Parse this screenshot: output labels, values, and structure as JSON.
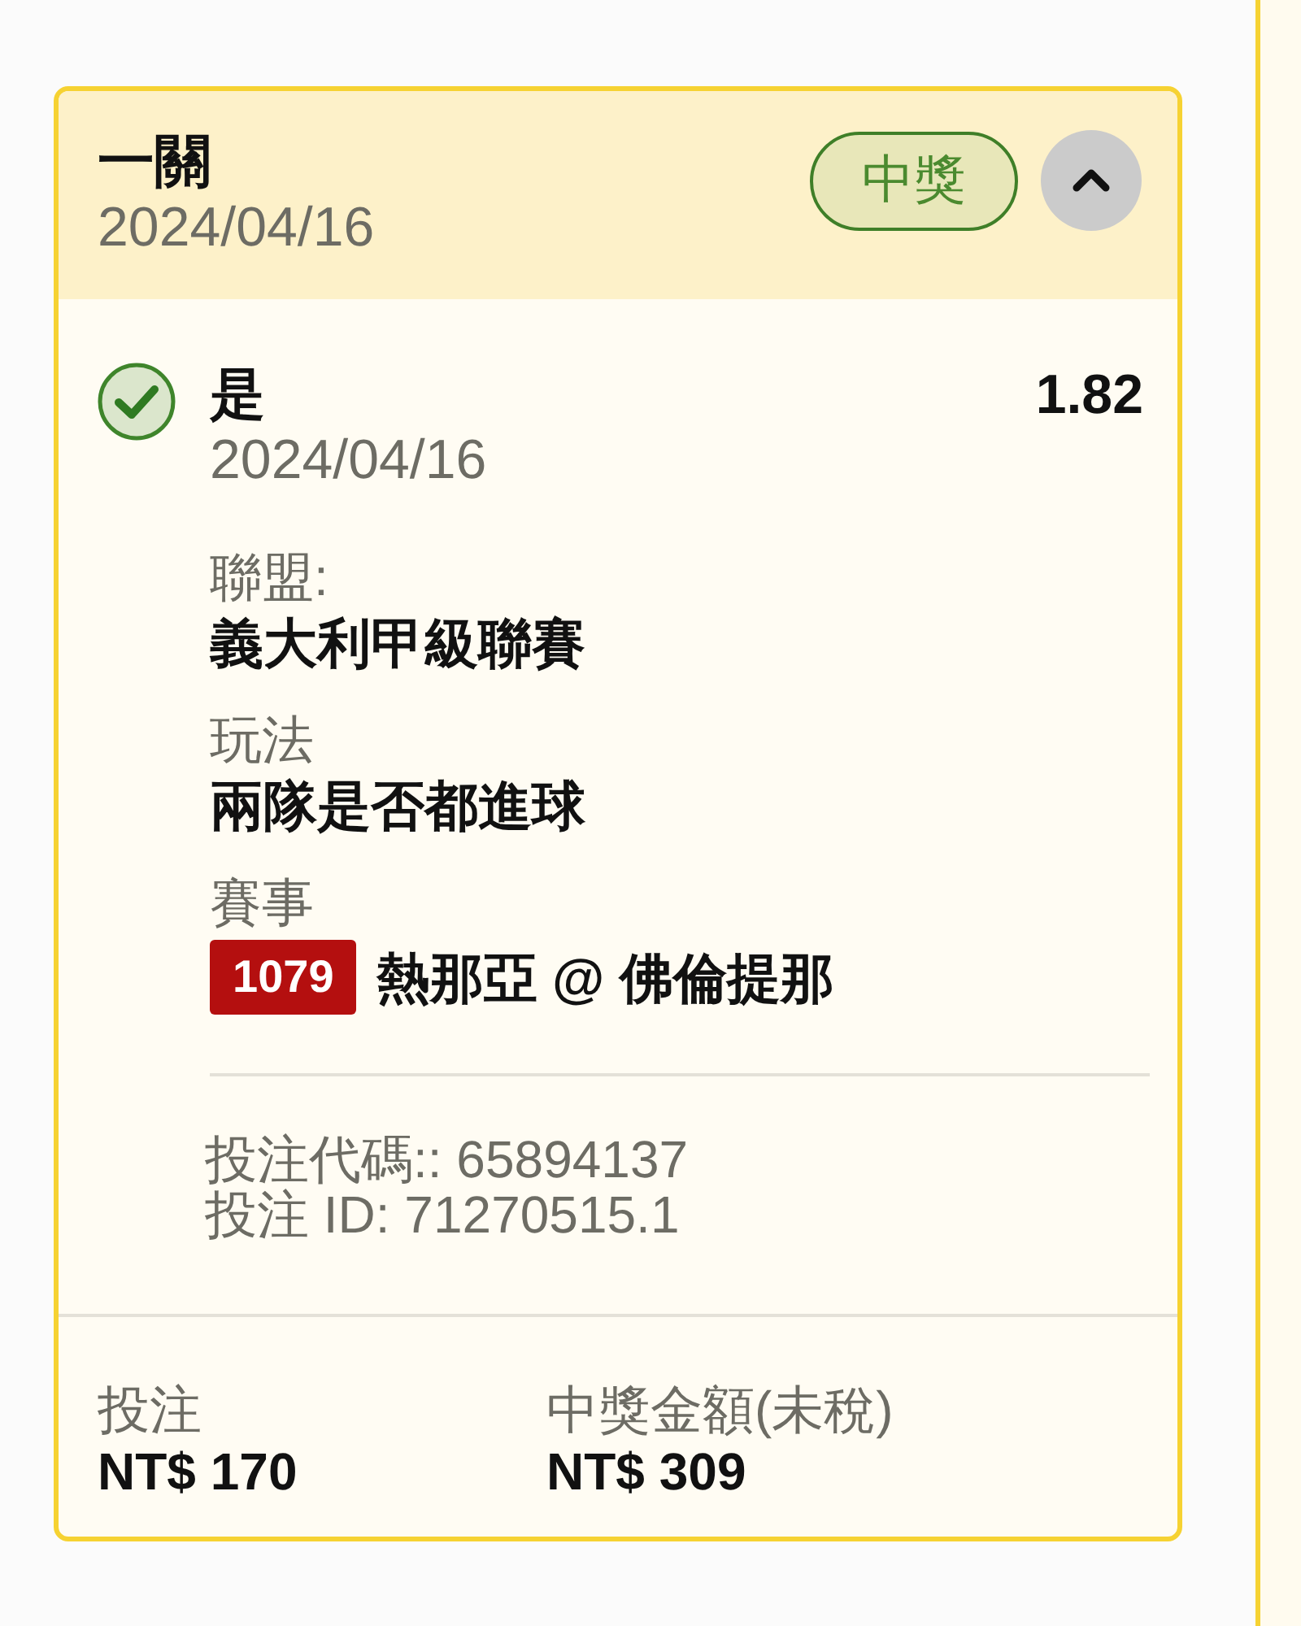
{
  "bet_card": {
    "header": {
      "title": "一關",
      "date": "2024/04/16",
      "status_badge": {
        "label": "中獎",
        "won": true
      },
      "collapse_button": {
        "expanded": true
      }
    },
    "selection": {
      "won": true,
      "pick": "是",
      "odds": "1.82",
      "date": "2024/04/16",
      "details": [
        {
          "kind": "text",
          "label": "聯盟:",
          "value": "義大利甲級聯賽"
        },
        {
          "kind": "text",
          "label": "玩法",
          "value": "兩隊是否都進球"
        },
        {
          "kind": "match",
          "label": "賽事",
          "match_number": "1079",
          "value": "熱那亞 @ 佛倫提那"
        }
      ],
      "references": [
        "投注代碼:: 65894137",
        "投注 ID: 71270515.1"
      ]
    },
    "totals": [
      {
        "label": "投注",
        "value": "NT$ 170"
      },
      {
        "label": "中獎金額(未稅)",
        "value": "NT$ 309"
      }
    ]
  }
}
